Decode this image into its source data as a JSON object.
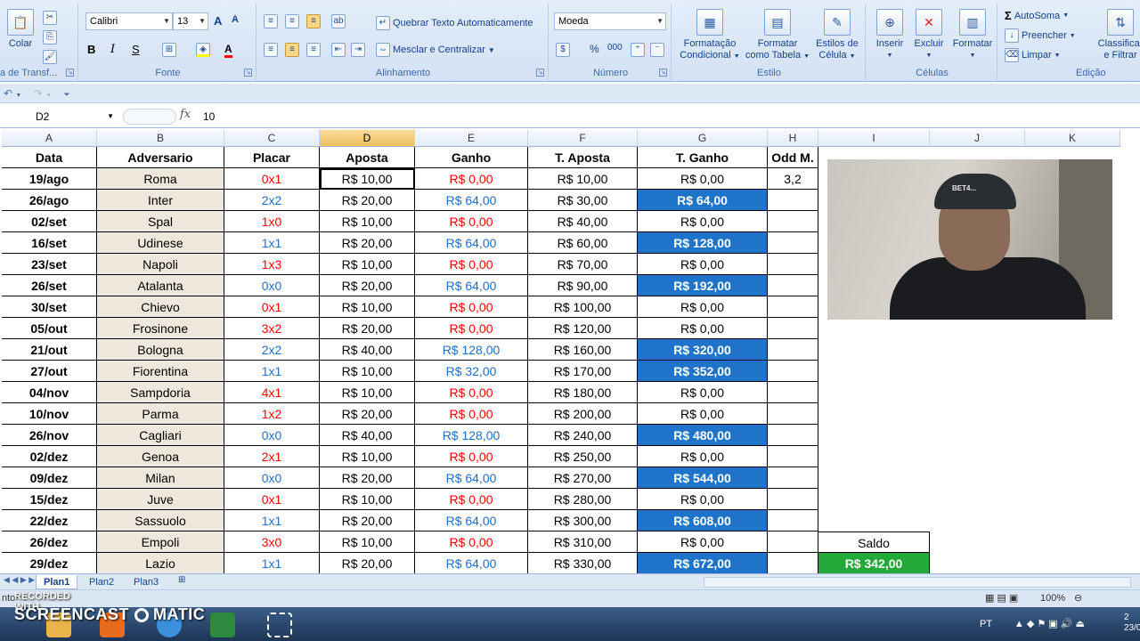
{
  "ribbon": {
    "clipboard": {
      "paste_label": "Colar",
      "group_label": "a de Transf..."
    },
    "font": {
      "name": "Calibri",
      "size": "13",
      "group_label": "Fonte"
    },
    "alignment": {
      "wrap_label": "Quebrar Texto Automaticamente",
      "merge_label": "Mesclar e Centralizar",
      "group_label": "Alinhamento"
    },
    "number": {
      "format": "Moeda",
      "group_label": "Número"
    },
    "styles": {
      "cond_label_1": "Formatação",
      "cond_label_2": "Condicional",
      "table_label_1": "Formatar",
      "table_label_2": "como Tabela",
      "cell_label_1": "Estilos de",
      "cell_label_2": "Célula",
      "group_label": "Estilo"
    },
    "cells": {
      "insert_label": "Inserir",
      "delete_label": "Excluir",
      "format_label": "Formatar",
      "group_label": "Células"
    },
    "editing": {
      "autosum_label": "AutoSoma",
      "fill_label": "Preencher",
      "clear_label": "Limpar",
      "sort_label_1": "Classificar",
      "sort_label_2": "e Filtrar",
      "group_label": "Edição"
    }
  },
  "formula_bar": {
    "name_box": "D2",
    "content": "10"
  },
  "columns": [
    "A",
    "B",
    "C",
    "D",
    "E",
    "F",
    "G",
    "H",
    "I",
    "J",
    "K"
  ],
  "headers": {
    "a": "Data",
    "b": "Adversario",
    "c": "Placar",
    "d": "Aposta",
    "e": "Ganho",
    "f": "T. Aposta",
    "g": "T. Ganho",
    "h": "Odd M."
  },
  "rows": [
    {
      "date": "19/ago",
      "opp": "Roma",
      "score": "0x1",
      "bet": "R$ 10,00",
      "gain": "R$ 0,00",
      "tbet": "R$ 10,00",
      "tgain": "R$ 0,00",
      "odd": "3,2"
    },
    {
      "date": "26/ago",
      "opp": "Inter",
      "score": "2x2",
      "bet": "R$ 20,00",
      "gain": "R$ 64,00",
      "tbet": "R$ 30,00",
      "tgain": "R$ 64,00"
    },
    {
      "date": "02/set",
      "opp": "Spal",
      "score": "1x0",
      "bet": "R$ 10,00",
      "gain": "R$ 0,00",
      "tbet": "R$ 40,00",
      "tgain": "R$ 0,00"
    },
    {
      "date": "16/set",
      "opp": "Udinese",
      "score": "1x1",
      "bet": "R$ 20,00",
      "gain": "R$ 64,00",
      "tbet": "R$ 60,00",
      "tgain": "R$ 128,00"
    },
    {
      "date": "23/set",
      "opp": "Napoli",
      "score": "1x3",
      "bet": "R$ 10,00",
      "gain": "R$ 0,00",
      "tbet": "R$ 70,00",
      "tgain": "R$ 0,00"
    },
    {
      "date": "26/set",
      "opp": "Atalanta",
      "score": "0x0",
      "bet": "R$ 20,00",
      "gain": "R$ 64,00",
      "tbet": "R$ 90,00",
      "tgain": "R$ 192,00"
    },
    {
      "date": "30/set",
      "opp": "Chievo",
      "score": "0x1",
      "bet": "R$ 10,00",
      "gain": "R$ 0,00",
      "tbet": "R$ 100,00",
      "tgain": "R$ 0,00"
    },
    {
      "date": "05/out",
      "opp": "Frosinone",
      "score": "3x2",
      "bet": "R$ 20,00",
      "gain": "R$ 0,00",
      "tbet": "R$ 120,00",
      "tgain": "R$ 0,00"
    },
    {
      "date": "21/out",
      "opp": "Bologna",
      "score": "2x2",
      "bet": "R$ 40,00",
      "gain": "R$ 128,00",
      "tbet": "R$ 160,00",
      "tgain": "R$ 320,00"
    },
    {
      "date": "27/out",
      "opp": "Fiorentina",
      "score": "1x1",
      "bet": "R$ 10,00",
      "gain": "R$ 32,00",
      "tbet": "R$ 170,00",
      "tgain": "R$ 352,00"
    },
    {
      "date": "04/nov",
      "opp": "Sampdoria",
      "score": "4x1",
      "bet": "R$ 10,00",
      "gain": "R$ 0,00",
      "tbet": "R$ 180,00",
      "tgain": "R$ 0,00"
    },
    {
      "date": "10/nov",
      "opp": "Parma",
      "score": "1x2",
      "bet": "R$ 20,00",
      "gain": "R$ 0,00",
      "tbet": "R$ 200,00",
      "tgain": "R$ 0,00"
    },
    {
      "date": "26/nov",
      "opp": "Cagliari",
      "score": "0x0",
      "bet": "R$ 40,00",
      "gain": "R$ 128,00",
      "tbet": "R$ 240,00",
      "tgain": "R$ 480,00"
    },
    {
      "date": "02/dez",
      "opp": "Genoa",
      "score": "2x1",
      "bet": "R$ 10,00",
      "gain": "R$ 0,00",
      "tbet": "R$ 250,00",
      "tgain": "R$ 0,00"
    },
    {
      "date": "09/dez",
      "opp": "Milan",
      "score": "0x0",
      "bet": "R$ 20,00",
      "gain": "R$ 64,00",
      "tbet": "R$ 270,00",
      "tgain": "R$ 544,00"
    },
    {
      "date": "15/dez",
      "opp": "Juve",
      "score": "0x1",
      "bet": "R$ 10,00",
      "gain": "R$ 0,00",
      "tbet": "R$ 280,00",
      "tgain": "R$ 0,00"
    },
    {
      "date": "22/dez",
      "opp": "Sassuolo",
      "score": "1x1",
      "bet": "R$ 20,00",
      "gain": "R$ 64,00",
      "tbet": "R$ 300,00",
      "tgain": "R$ 608,00"
    },
    {
      "date": "26/dez",
      "opp": "Empoli",
      "score": "3x0",
      "bet": "R$ 10,00",
      "gain": "R$ 0,00",
      "tbet": "R$ 310,00",
      "tgain": "R$ 0,00"
    },
    {
      "date": "29/dez",
      "opp": "Lazio",
      "score": "1x1",
      "bet": "R$ 20,00",
      "gain": "R$ 64,00",
      "tbet": "R$ 330,00",
      "tgain": "R$ 672,00"
    }
  ],
  "saldo": {
    "label": "Saldo",
    "value": "R$ 342,00"
  },
  "sheet_tabs": [
    "Plan1",
    "Plan2",
    "Plan3"
  ],
  "status": {
    "left": "nto",
    "zoom": "100%"
  },
  "webcam": {
    "cap_text": "BET4..."
  },
  "watermark": {
    "line1": "RECORDED WITH",
    "line2": "SCREENCAST",
    "line3": "MATIC"
  },
  "tray": {
    "lang": "PT",
    "date_partial": "2",
    "date_partial2": "23/0"
  },
  "colors": {
    "highlight_blue": "#1f74c9",
    "saldo_green": "#23a83a",
    "loss_red": "#ff0000",
    "gain_blue": "#1f6ec8",
    "selected_col": "#f1c15f"
  }
}
